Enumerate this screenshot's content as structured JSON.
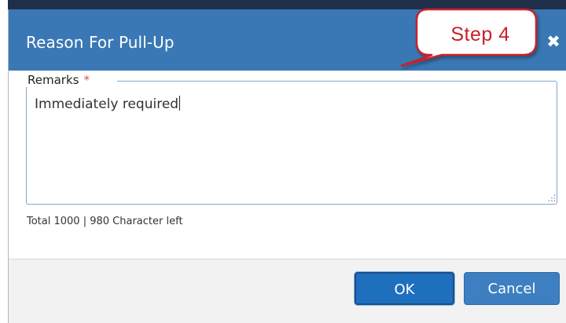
{
  "dialog": {
    "title": "Reason For Pull-Up",
    "close_icon": "close-icon"
  },
  "remarks": {
    "label": "Remarks",
    "required_marker": "*",
    "value": "Immediately required",
    "counter_text": "Total 1000 | 980 Character left"
  },
  "footer": {
    "ok_label": "OK",
    "cancel_label": "Cancel"
  },
  "callout": {
    "text": "Step  4"
  },
  "colors": {
    "header": "#3a78b5",
    "primary_button": "#1f6fbf",
    "callout_border": "#c8202a",
    "required": "#d9534f"
  }
}
